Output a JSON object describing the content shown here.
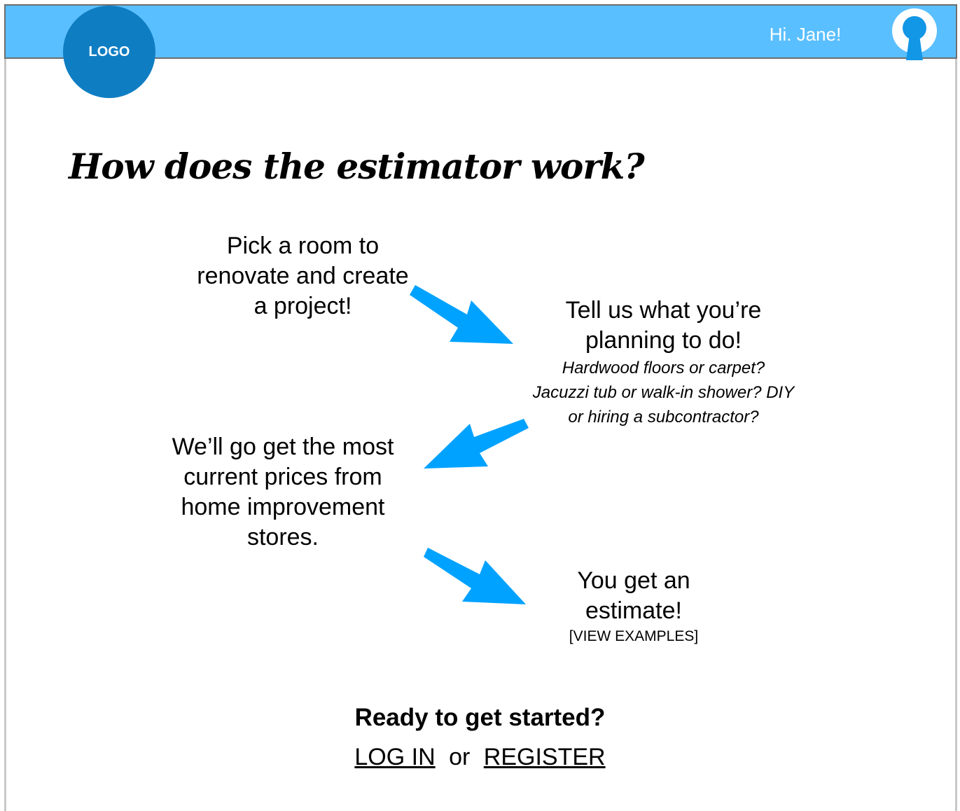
{
  "header": {
    "logo_label": "LOGO",
    "greeting": "Hi. Jane!",
    "avatar_icon": "user-avatar-icon",
    "bar_color": "#5abfff",
    "logo_color": "#0f7dc2"
  },
  "main": {
    "headline": "How does the estimator work?",
    "steps": [
      {
        "text": "Pick a room to renovate and create a project!"
      },
      {
        "text": "Tell us what you’re planning to do!",
        "note": "Hardwood floors or carpet? Jacuzzi tub or walk-in shower? DIY or hiring a subcontractor?"
      },
      {
        "text": "We’ll go get the most current prices from home improvement stores."
      },
      {
        "text": "You get an estimate!",
        "link": "[VIEW EXAMPLES]"
      }
    ],
    "arrow_color": "#00a2ff"
  },
  "cta": {
    "title": "Ready to get started?",
    "login_label": "LOG IN",
    "separator": "or",
    "register_label": "REGISTER"
  }
}
